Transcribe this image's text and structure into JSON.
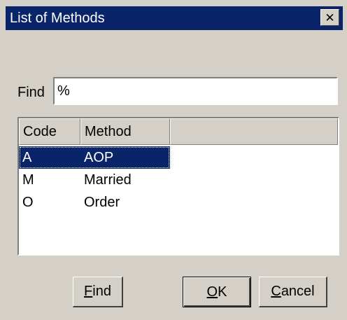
{
  "window": {
    "title": "List of Methods",
    "close_icon": "close-icon"
  },
  "search": {
    "label": "Find",
    "value": "%"
  },
  "table": {
    "columns": [
      "Code",
      "Method",
      ""
    ],
    "rows": [
      {
        "code": "A",
        "method": "AOP",
        "selected": true
      },
      {
        "code": "M",
        "method": "Married",
        "selected": false
      },
      {
        "code": "O",
        "method": "Order",
        "selected": false
      }
    ]
  },
  "buttons": {
    "find": {
      "mnemonic": "F",
      "rest": "ind"
    },
    "ok": {
      "mnemonic": "O",
      "rest": "K"
    },
    "cancel": {
      "mnemonic": "C",
      "rest": "ancel"
    }
  },
  "colors": {
    "titlebar": "#0a246a",
    "face": "#d4d0c8",
    "selection": "#0a246a"
  }
}
